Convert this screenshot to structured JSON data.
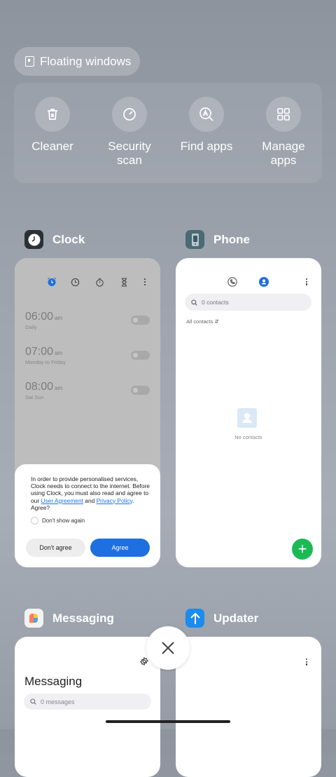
{
  "floating_windows": {
    "label": "Floating windows"
  },
  "tools": [
    {
      "label": "Cleaner",
      "icon": "trash-icon"
    },
    {
      "label": "Security scan",
      "icon": "security-scan-icon"
    },
    {
      "label": "Find apps",
      "icon": "find-apps-icon"
    },
    {
      "label": "Manage apps",
      "icon": "manage-apps-icon"
    }
  ],
  "apps": {
    "clock": {
      "name": "Clock",
      "alarms": [
        {
          "time": "06:00",
          "ampm": "am",
          "repeat": "Daily"
        },
        {
          "time": "07:00",
          "ampm": "am",
          "repeat": "Monday to Friday"
        },
        {
          "time": "08:00",
          "ampm": "am",
          "repeat": "Sat Sun"
        }
      ],
      "dialog": {
        "text_1": "In order to provide personalised services, Clock needs to connect to the internet. Before using Clock, you must also read and agree to our ",
        "link_agreement": "User Agreement",
        "text_and": " and ",
        "link_privacy": "Privacy Policy",
        "text_2": ". Agree?",
        "dont_show": "Don't show again",
        "btn_disagree": "Don't agree",
        "btn_agree": "Agree"
      }
    },
    "phone": {
      "name": "Phone",
      "search_placeholder": "0 contacts",
      "filter": "All contacts",
      "empty": "No contacts"
    },
    "messaging": {
      "name": "Messaging",
      "title": "Messaging",
      "search_placeholder": "0 messages"
    },
    "updater": {
      "name": "Updater"
    }
  },
  "colors": {
    "accent_blue": "#1e6fe0",
    "fab_green": "#1db954",
    "updater_blue": "#1a8cf0"
  }
}
